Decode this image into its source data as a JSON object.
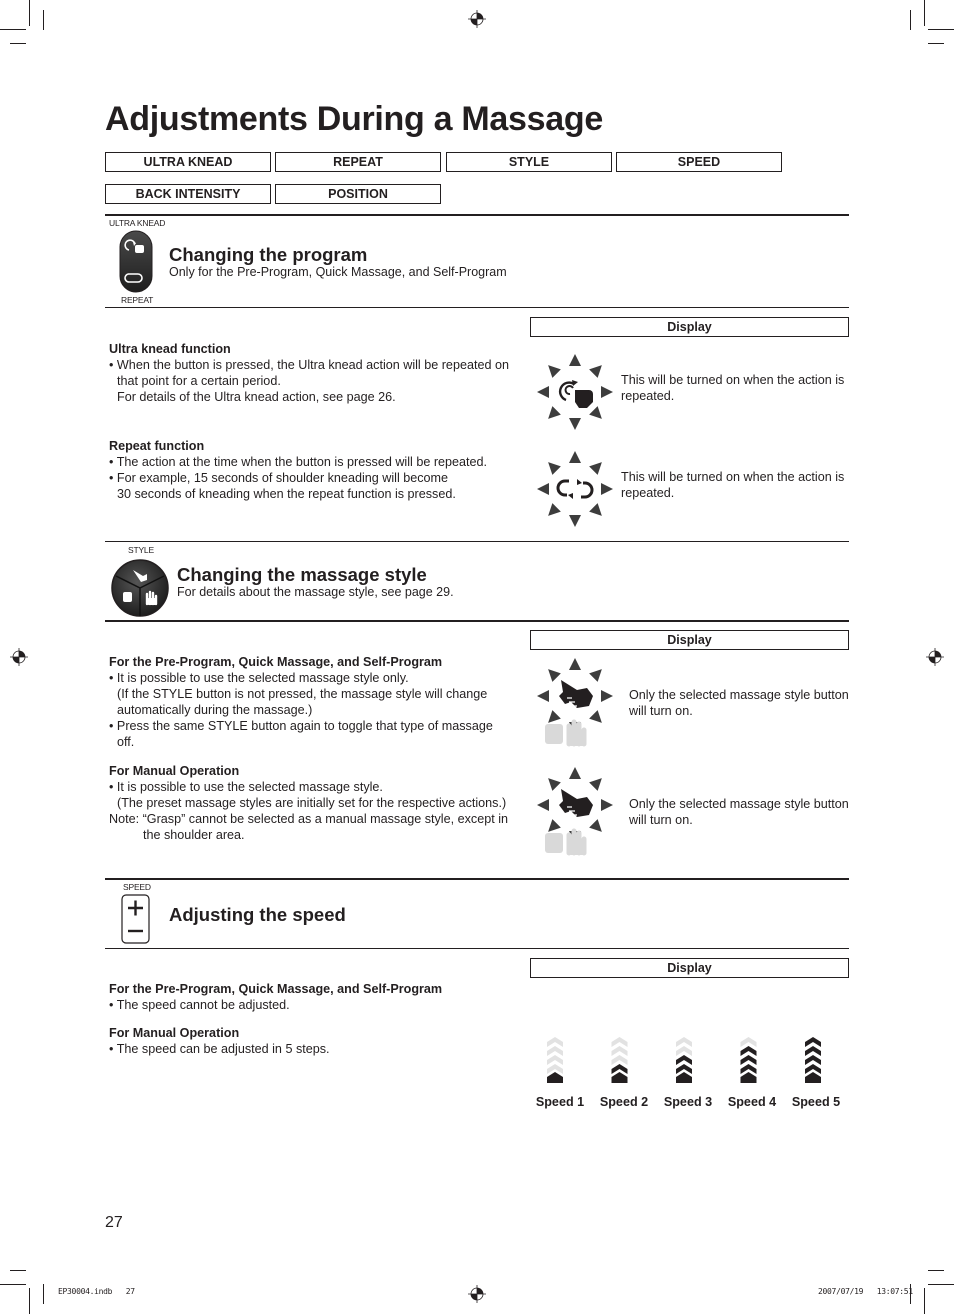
{
  "page": {
    "title": "Adjustments During a Massage",
    "page_number": "27"
  },
  "tabs": [
    {
      "label": "ULTRA KNEAD"
    },
    {
      "label": "REPEAT"
    },
    {
      "label": "STYLE"
    },
    {
      "label": "SPEED"
    },
    {
      "label": "BACK INTENSITY"
    },
    {
      "label": "POSITION"
    }
  ],
  "program": {
    "icon_top_label": "ULTRA KNEAD",
    "icon_bottom_label": "REPEAT",
    "heading": "Changing the program",
    "subheading": "Only for the Pre-Program, Quick Massage, and Self-Program",
    "display_label": "Display",
    "ultra": {
      "heading": "Ultra knead function",
      "bullet1": "When the button is pressed, the Ultra knead action will be repeated on",
      "bullet1_cont": "that point for a certain period.",
      "bullet1_cont2": "For details of the Ultra knead action, see page 26.",
      "display_desc": "This will be turned on when the action is repeated."
    },
    "repeat": {
      "heading": "Repeat function",
      "bullet1": "The action at the time when the button is pressed will be repeated.",
      "bullet2": "For example, 15 seconds of shoulder kneading will become",
      "bullet2_cont": "30 seconds of kneading when the repeat function is pressed.",
      "display_desc": "This will be turned on when the action is repeated."
    }
  },
  "style": {
    "icon_label": "STYLE",
    "heading": "Changing the massage style",
    "subheading": "For details about the massage style, see page 29.",
    "display_label": "Display",
    "preprogram": {
      "heading": "For the Pre-Program, Quick Massage, and Self-Program",
      "bullet1": "It is possible to use the selected massage style only.",
      "bullet1_cont": "(If the STYLE button is not pressed, the massage style will change",
      "bullet1_cont2": "automatically during the massage.)",
      "bullet2": "Press the same STYLE button again to toggle that type of massage",
      "bullet2_cont": "off.",
      "display_desc": "Only the selected massage style button will turn on."
    },
    "manual": {
      "heading": "For Manual Operation",
      "bullet1": "It is possible to use the selected massage style.",
      "bullet1_cont": "(The preset massage styles are initially set for the respective actions.)",
      "note": "Note: “Grasp” cannot be selected as a manual massage style, except in",
      "note_cont": "the shoulder area.",
      "display_desc": "Only the selected massage style button will turn on."
    }
  },
  "speed": {
    "icon_label": "SPEED",
    "heading": "Adjusting the speed",
    "display_label": "Display",
    "preprogram": {
      "heading": "For the Pre-Program, Quick Massage, and Self-Program",
      "bullet1": "The speed cannot be adjusted."
    },
    "manual": {
      "heading": "For Manual Operation",
      "bullet1": "The speed can be adjusted in 5 steps."
    },
    "total_steps": 5,
    "levels": [
      {
        "label": "Speed 1",
        "active_steps": 1
      },
      {
        "label": "Speed 2",
        "active_steps": 2
      },
      {
        "label": "Speed 3",
        "active_steps": 3
      },
      {
        "label": "Speed 4",
        "active_steps": 4
      },
      {
        "label": "Speed 5",
        "active_steps": 5
      }
    ],
    "colors": {
      "active": "#231f20",
      "inactive": "#e2e2e2"
    }
  },
  "slug": {
    "file": "EP30004.indb   27",
    "datetime": "2007/07/19   13:07:51"
  },
  "bullet_char": "•"
}
